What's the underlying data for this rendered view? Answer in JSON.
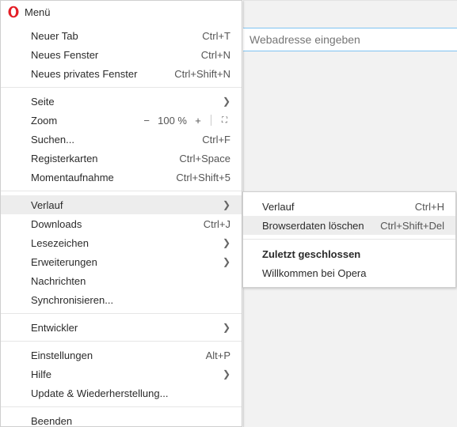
{
  "header": {
    "title": "Menü"
  },
  "addressbar": {
    "placeholder": "Webadresse eingeben"
  },
  "menu": {
    "new_tab": {
      "label": "Neuer Tab",
      "shortcut": "Ctrl+T"
    },
    "new_window": {
      "label": "Neues Fenster",
      "shortcut": "Ctrl+N"
    },
    "new_private": {
      "label": "Neues privates Fenster",
      "shortcut": "Ctrl+Shift+N"
    },
    "page": {
      "label": "Seite"
    },
    "zoom": {
      "label": "Zoom",
      "minus": "−",
      "value": "100 %",
      "plus": "+",
      "full": "⛶"
    },
    "find": {
      "label": "Suchen...",
      "shortcut": "Ctrl+F"
    },
    "tabs": {
      "label": "Registerkarten",
      "shortcut": "Ctrl+Space"
    },
    "snapshot": {
      "label": "Momentaufnahme",
      "shortcut": "Ctrl+Shift+5"
    },
    "history": {
      "label": "Verlauf"
    },
    "downloads": {
      "label": "Downloads",
      "shortcut": "Ctrl+J"
    },
    "bookmarks": {
      "label": "Lesezeichen"
    },
    "extensions": {
      "label": "Erweiterungen"
    },
    "news": {
      "label": "Nachrichten"
    },
    "sync": {
      "label": "Synchronisieren..."
    },
    "developer": {
      "label": "Entwickler"
    },
    "settings": {
      "label": "Einstellungen",
      "shortcut": "Alt+P"
    },
    "help": {
      "label": "Hilfe"
    },
    "update": {
      "label": "Update & Wiederherstellung..."
    },
    "exit": {
      "label": "Beenden"
    }
  },
  "submenu": {
    "history_item": {
      "label": "Verlauf",
      "shortcut": "Ctrl+H"
    },
    "clear_data": {
      "label": "Browserdaten löschen",
      "shortcut": "Ctrl+Shift+Del"
    },
    "recently_closed_heading": "Zuletzt geschlossen",
    "welcome": {
      "label": "Willkommen bei Opera"
    }
  }
}
